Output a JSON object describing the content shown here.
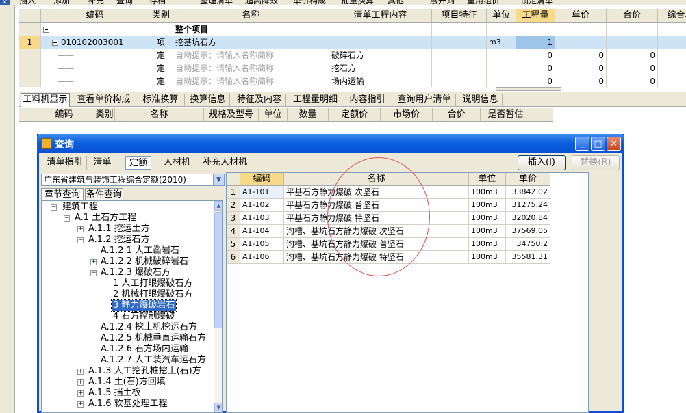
{
  "toolbar": {
    "items": [
      "插入",
      "添加",
      "补充",
      "查询",
      "存档",
      "整理清单",
      "超高降效",
      "单价构成",
      "批量换算",
      "其他",
      "展开到",
      "重用组价",
      "锁定清单"
    ]
  },
  "top_grid": {
    "headers": [
      "编码",
      "类别",
      "名称",
      "清单工程内容",
      "项目特征",
      "单位",
      "工程量",
      "单价",
      "合价",
      "综合单价"
    ],
    "group_row": {
      "label": "整个项目"
    },
    "main_row": {
      "index": "1",
      "code": "010102003001",
      "type": "项",
      "name": "挖基坑石方",
      "unit": "m3",
      "qty": "1"
    },
    "sub_rows": [
      {
        "type": "定",
        "name_hint": "自动提示：请输入名称简称",
        "content": "破碎石方",
        "qty": "0",
        "price": "0",
        "total": "0"
      },
      {
        "type": "定",
        "name_hint": "自动提示：请输入名称简称",
        "content": "挖石方",
        "qty": "0",
        "price": "0",
        "total": "0"
      },
      {
        "type": "定",
        "name_hint": "自动提示：请输入名称简称",
        "content": "场内运输",
        "qty": "0",
        "price": "0",
        "total": "0"
      }
    ]
  },
  "tabs": [
    "工料机显示",
    "查看单价构成",
    "标准换算",
    "换算信息",
    "特征及内容",
    "工程量明细",
    "内容指引",
    "查询用户清单",
    "说明信息"
  ],
  "lower_headers": [
    "编码",
    "类别",
    "名称",
    "规格及型号",
    "单位",
    "数量",
    "定额价",
    "市场价",
    "合价",
    "是否暂估"
  ],
  "dialog": {
    "title": "查询",
    "tabs": [
      "清单指引",
      "清单",
      "定额",
      "人材机",
      "补充人材机"
    ],
    "insert_label": "插入(I)",
    "replace_label": "替换(R)",
    "quota_select": "广东省建筑与装饰工程综合定额(2010)",
    "subtabs": [
      "章节查询",
      "条件查询"
    ],
    "tree": [
      {
        "label": "建筑工程",
        "box": "−"
      },
      {
        "label": "A.1 土石方工程",
        "box": "−"
      },
      {
        "label": "A.1.1 挖运土方",
        "box": "+"
      },
      {
        "label": "A.1.2 挖运石方",
        "box": "−"
      },
      {
        "label": "A.1.2.1 人工凿岩石",
        "box": ""
      },
      {
        "label": "A.1.2.2 机械破碎岩石",
        "box": "+"
      },
      {
        "label": "A.1.2.3 爆破石方",
        "box": "−"
      },
      {
        "label": "1 人工打眼爆破石方",
        "box": ""
      },
      {
        "label": "2 机械打眼爆破石方",
        "box": ""
      },
      {
        "label": "3 静力爆破岩石",
        "box": ""
      },
      {
        "label": "4 石方控制爆破",
        "box": ""
      },
      {
        "label": "A.1.2.4 挖土机挖运石方",
        "box": ""
      },
      {
        "label": "A.1.2.5 机械垂直运输石方",
        "box": ""
      },
      {
        "label": "A.1.2.6 石方场内运输",
        "box": ""
      },
      {
        "label": "A.1.2.7 人工装汽车运石方",
        "box": ""
      },
      {
        "label": "A.1.3 人工挖孔桩挖土(石)方",
        "box": "+"
      },
      {
        "label": "A.1.4 土(石)方回填",
        "box": "+"
      },
      {
        "label": "A.1.5 挡土板",
        "box": "+"
      },
      {
        "label": "A.1.6 软基处理工程",
        "box": "+"
      }
    ],
    "results": {
      "headers": [
        "编码",
        "名称",
        "单位",
        "单价"
      ],
      "rows": [
        {
          "index": "1",
          "code": "A1-101",
          "name": "平基石方静力爆破 次坚石",
          "unit": "100m3",
          "price": "33842.02"
        },
        {
          "index": "2",
          "code": "A1-102",
          "name": "平基石方静力爆破 普坚石",
          "unit": "100m3",
          "price": "31275.24"
        },
        {
          "index": "3",
          "code": "A1-103",
          "name": "平基石方静力爆破 特坚石",
          "unit": "100m3",
          "price": "32020.84"
        },
        {
          "index": "4",
          "code": "A1-104",
          "name": "沟槽、基坑石方静力爆破 次坚石",
          "unit": "100m3",
          "price": "37569.05"
        },
        {
          "index": "5",
          "code": "A1-105",
          "name": "沟槽、基坑石方静力爆破 普坚石",
          "unit": "100m3",
          "price": "34750.2"
        },
        {
          "index": "6",
          "code": "A1-106",
          "name": "沟槽、基坑石方静力爆破 特坚石",
          "unit": "100m3",
          "price": "35581.31"
        }
      ]
    }
  },
  "colors": {
    "title_blue": "#0b5fe0",
    "selection_blue": "#316ac5",
    "header_highlight": "#f7d98a",
    "annotation_red": "#e05050"
  }
}
